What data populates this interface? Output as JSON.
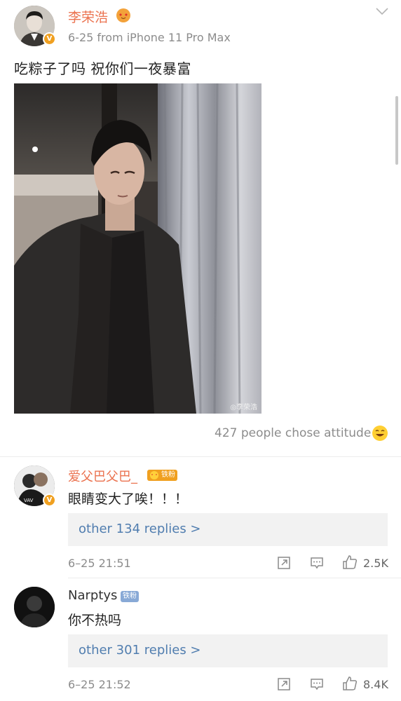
{
  "post": {
    "author": "李荣浩",
    "meta": "6-25   from iPhone 11 Pro Max",
    "text": "吃粽子了吗 祝你们一夜暴富",
    "verified_mark": "V",
    "photo_watermark": "李荣浩",
    "attitude_text": "427 people chose attitude"
  },
  "comments": [
    {
      "user": "爱父巴父巴_",
      "badge": "铁粉",
      "verified_mark": "V",
      "text": "眼睛变大了唉！！！",
      "replies_link": "other 134 replies >",
      "time": "6–25 21:51",
      "likes": "2.5K"
    },
    {
      "user": "Narptys",
      "badge": "铁粉",
      "text": "你不热吗",
      "replies_link": "other 301 replies >",
      "time": "6–25 21:52",
      "likes": "8.4K"
    }
  ],
  "colors": {
    "name_orange": "#eb7350",
    "link_blue": "#507daf",
    "meta_gray": "#8c8c8c",
    "badge_orange": "#f0a020",
    "badge_blue": "#88a9d6"
  }
}
